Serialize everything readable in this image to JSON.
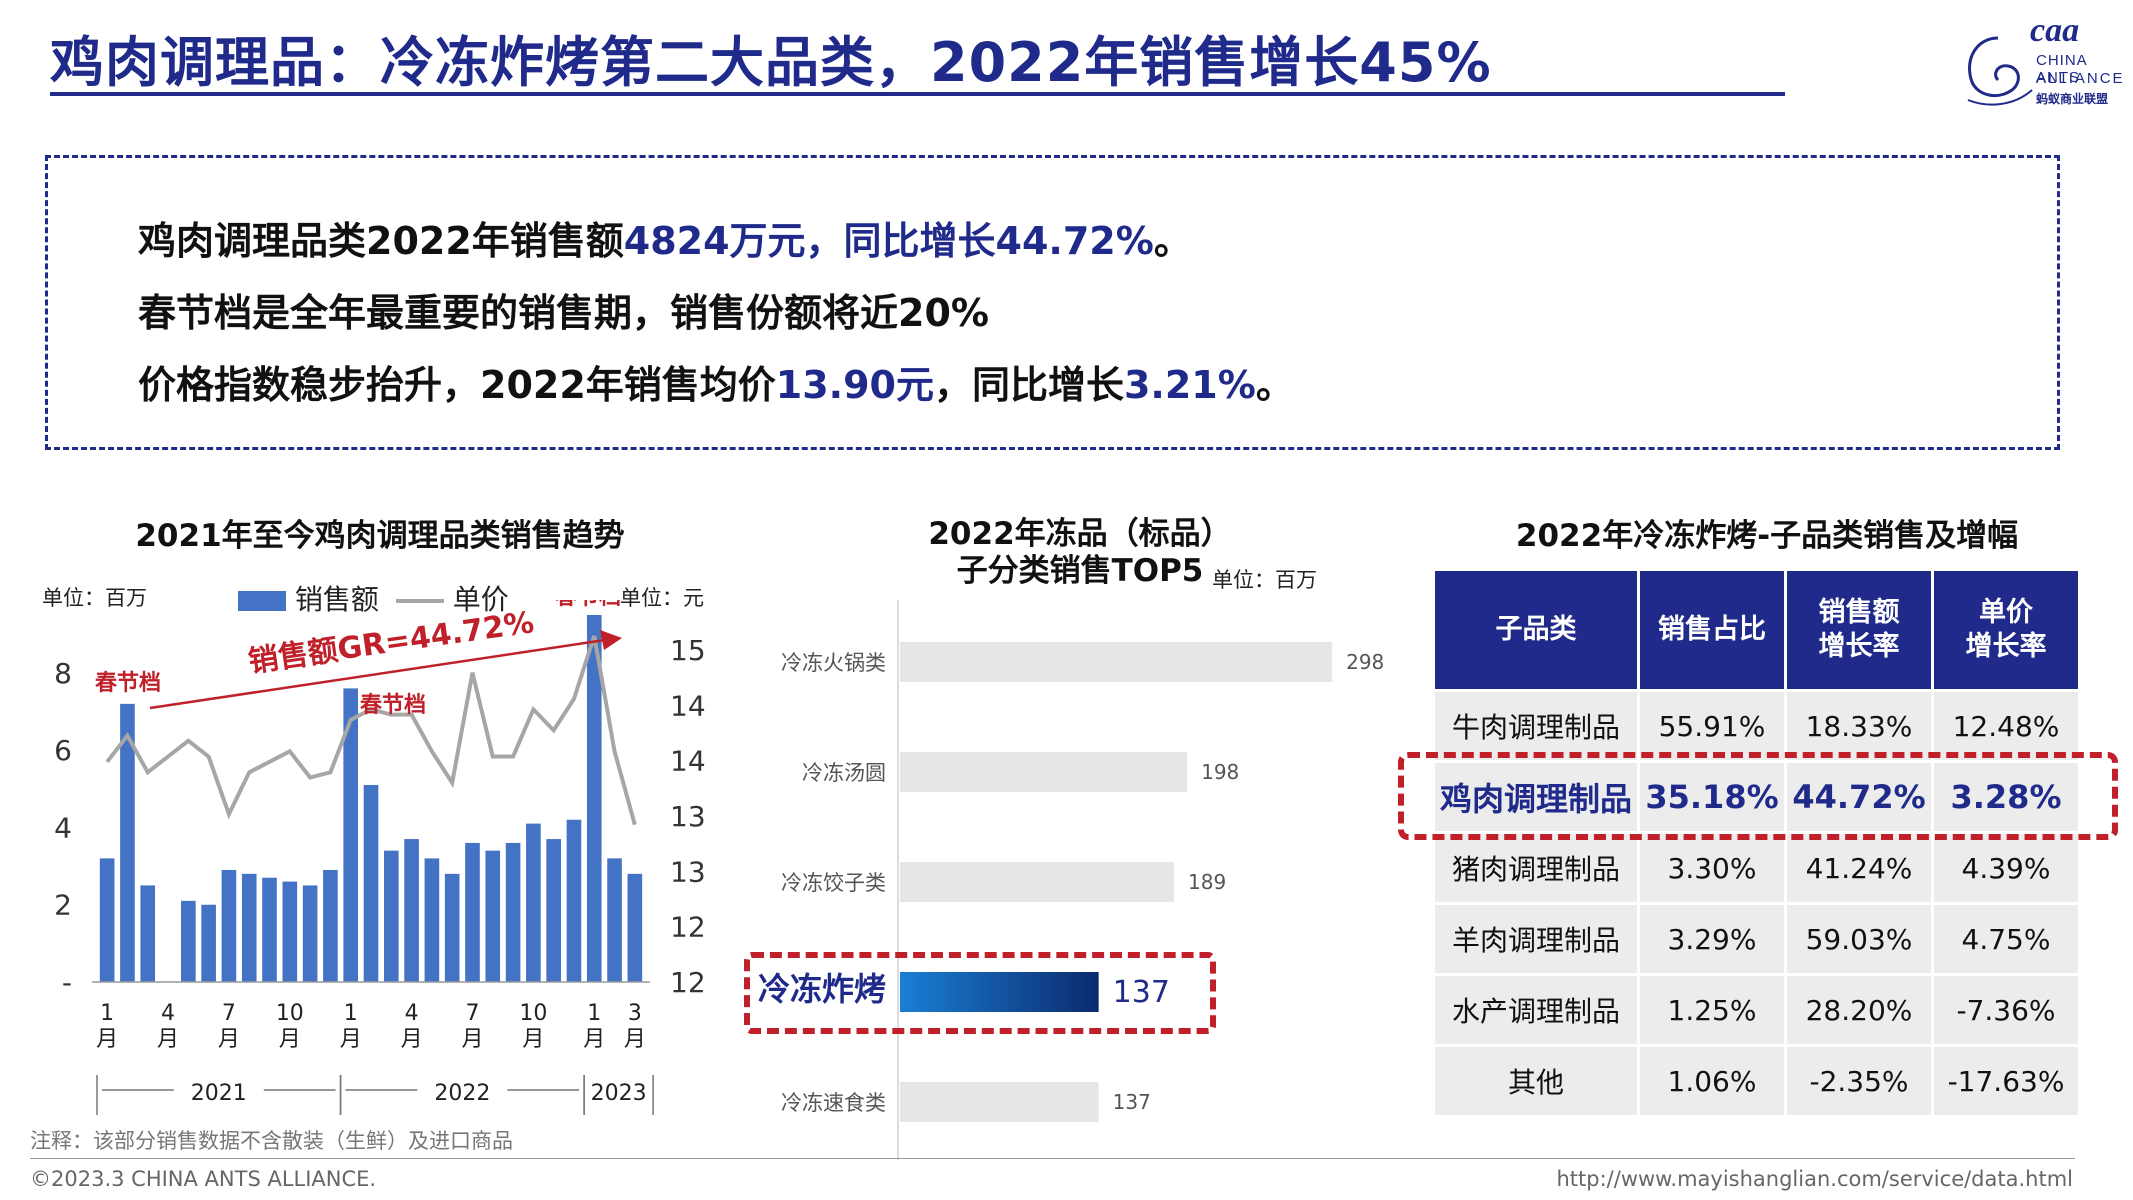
{
  "header": {
    "title": "鸡肉调理品：冷冻炸烤第二大品类，2022年销售增长45%",
    "logo_mark": "caa",
    "logo_line1": "CHINA ANTS",
    "logo_line2": "ALLIANCE",
    "logo_line3": "蚂蚁商业联盟"
  },
  "summary": {
    "line1_a": "鸡肉调理品类2022年销售额",
    "line1_b": "4824万元，同比增长44.72%",
    "line1_c": "。",
    "line2": "春节档是全年最重要的销售期，销售份额将近20%",
    "line3_a": "价格指数稳步抬升，2022年销售均价",
    "line3_b": "13.90元",
    "line3_c": "，同比增长",
    "line3_d": "3.21%",
    "line3_e": "。"
  },
  "chart_data": [
    {
      "type": "bar",
      "title": "2021年至今鸡肉调理品类销售趋势",
      "left_unit": "单位：百万",
      "right_unit": "单位：元",
      "legend": [
        "销售额",
        "单价"
      ],
      "growth_label": "销售额GR=44.72%",
      "annotations": [
        "春节档",
        "春节档",
        "春节档"
      ],
      "ylim": [
        0,
        9.5
      ],
      "yticks": [
        "-",
        "2",
        "4",
        "6",
        "8"
      ],
      "y2lim": [
        11.8,
        15.3
      ],
      "y2ticks": [
        "12",
        "12",
        "13",
        "13",
        "14",
        "14",
        "15"
      ],
      "x_tick_labels": [
        "1\n月",
        "4\n月",
        "7\n月",
        "10\n月",
        "1\n月",
        "4\n月",
        "7\n月",
        "10\n月",
        "1\n月",
        "3\n月"
      ],
      "year_labels": [
        "2021",
        "2022",
        "2023"
      ],
      "series": [
        {
          "name": "销售额",
          "type": "bar",
          "values": [
            3.2,
            7.2,
            2.5,
            0,
            2.1,
            2.0,
            2.9,
            2.8,
            2.7,
            2.6,
            2.5,
            2.9,
            7.6,
            5.1,
            3.4,
            3.7,
            3.2,
            2.8,
            3.6,
            3.4,
            3.6,
            4.1,
            3.7,
            4.2,
            9.5,
            3.2,
            2.8
          ]
        },
        {
          "name": "单价",
          "type": "line",
          "values": [
            13.9,
            14.15,
            13.8,
            13.95,
            14.1,
            13.95,
            13.4,
            13.8,
            13.9,
            14.0,
            13.75,
            13.8,
            14.3,
            14.4,
            14.35,
            14.35,
            14.0,
            13.7,
            14.75,
            13.95,
            13.95,
            14.4,
            14.2,
            14.5,
            15.1,
            14.0,
            13.3
          ]
        }
      ]
    },
    {
      "type": "bar",
      "orientation": "horizontal",
      "title_line1": "2022年冻品（标品）",
      "title_line2": "子分类销售TOP5",
      "unit": "单位：百万",
      "categories": [
        "冷冻火锅类",
        "冷冻汤圆",
        "冷冻饺子类",
        "冷冻炸烤",
        "冷冻速食类"
      ],
      "values": [
        298,
        198,
        189,
        137,
        137
      ],
      "highlight": "冷冻炸烤",
      "colors": {
        "bar": "#e6e6e6",
        "highlight_start": "#1a7fd4",
        "highlight_end": "#0b2a6e"
      }
    },
    {
      "type": "table",
      "title": "2022年冷冻炸烤-子品类销售及增幅",
      "columns": [
        "子品类",
        "销售占比",
        "销售额\n增长率",
        "单价\n增长率"
      ],
      "rows": [
        [
          "牛肉调理制品",
          "55.91%",
          "18.33%",
          "12.48%"
        ],
        [
          "鸡肉调理制品",
          "35.18%",
          "44.72%",
          "3.28%"
        ],
        [
          "猪肉调理制品",
          "3.30%",
          "41.24%",
          "4.39%"
        ],
        [
          "羊肉调理制品",
          "3.29%",
          "59.03%",
          "4.75%"
        ],
        [
          "水产调理制品",
          "1.25%",
          "28.20%",
          "-7.36%"
        ],
        [
          "其他",
          "1.06%",
          "-2.35%",
          "-17.63%"
        ]
      ],
      "highlight_row": 1
    }
  ],
  "colors": {
    "brand": "#1f2a8a",
    "bar": "#4472c4",
    "line": "#a6a6a6",
    "accent_red": "#c0202a"
  },
  "footer": {
    "note": "注释：该部分销售数据不含散装（生鲜）及进口商品",
    "copyright": "©2023.3 CHINA ANTS ALLIANCE.",
    "url": "http://www.mayishanglian.com/service/data.html"
  }
}
